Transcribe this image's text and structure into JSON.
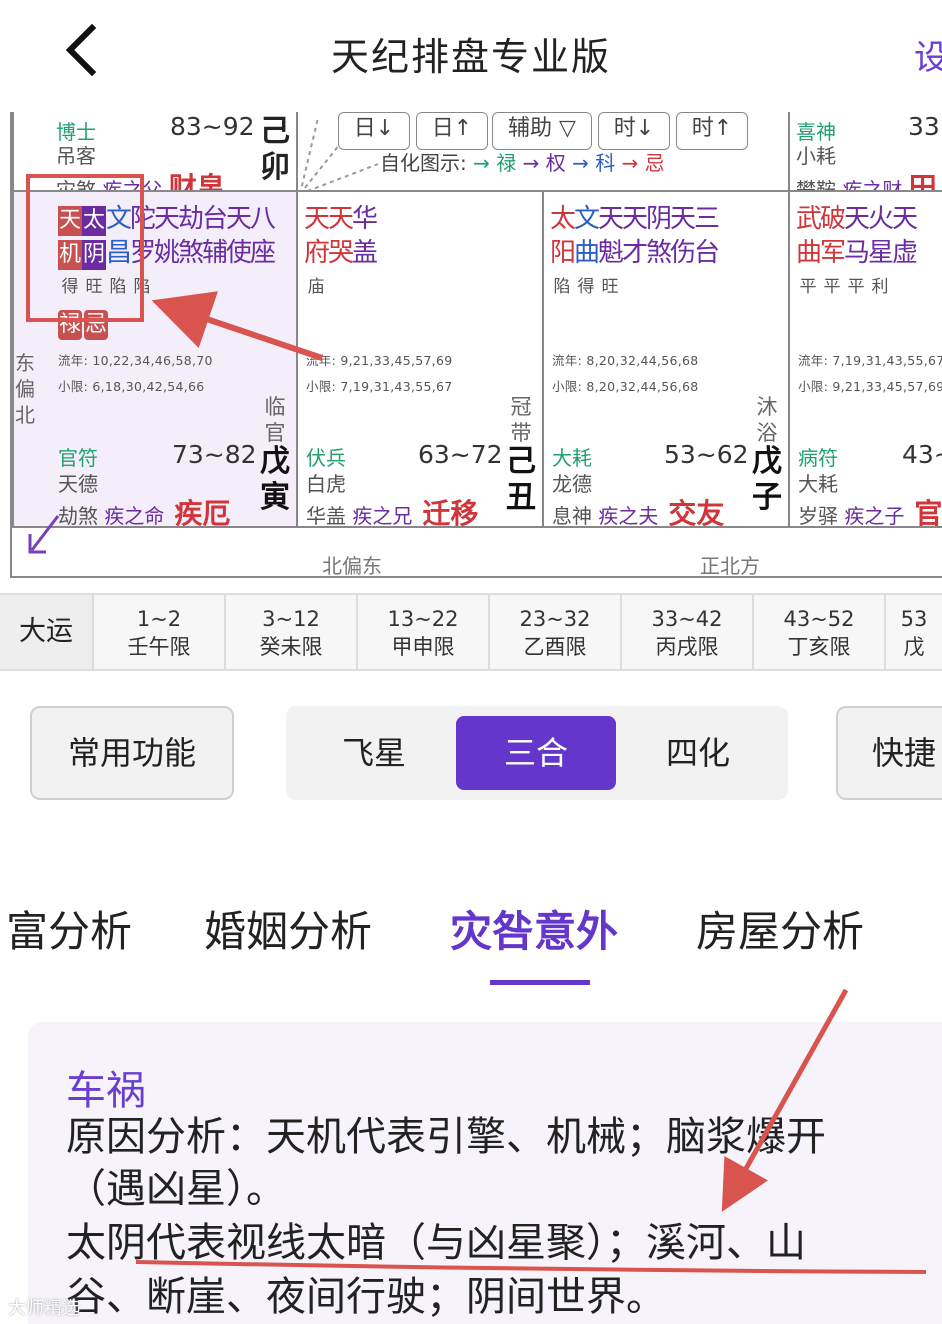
{
  "header": {
    "title": "天纪排盘专业版",
    "right_cut": "设"
  },
  "chart": {
    "top_cells": {
      "c1": {
        "l1": "博士",
        "l2": "吊客",
        "l3a": "灾煞",
        "l3b": "疾之父",
        "pal": "财帛",
        "range": "83~92",
        "stem": "己",
        "branch": "卯"
      },
      "c4": {
        "l1": "喜神",
        "l2": "小耗",
        "l3a": "攀鞍",
        "l3b": "疾之财",
        "pal": "田",
        "range": "33~"
      }
    },
    "center": {
      "btns": [
        "日↓",
        "日↑",
        "辅助 ▽",
        "时↓",
        "时↑"
      ],
      "legend_label": "自化图示:",
      "legend": [
        "→ 禄",
        "→ 权",
        "→ 科",
        "→ 忌"
      ]
    },
    "cells": [
      {
        "stars_r1": [
          "天",
          "太",
          "文",
          "陀",
          "天",
          "劫",
          "台",
          "天",
          "八"
        ],
        "stars_r2": [
          "机",
          "阴",
          "昌",
          "罗",
          "姚",
          "煞",
          "辅",
          "使",
          "座"
        ],
        "bright": [
          "得",
          "旺",
          "陷",
          "陷"
        ],
        "tags": [
          "禄",
          "忌"
        ],
        "liunian": "流年: 10,22,34,46,58,70",
        "xiaoxian": "小限: 6,18,30,42,54,66",
        "state": [
          "临",
          "官"
        ],
        "b1": "官符",
        "b2": "天德",
        "range": "73~82",
        "stem": "戊",
        "branch": "寅",
        "b3a": "劫煞",
        "b3b": "疾之命",
        "pal": "疾厄"
      },
      {
        "stars_r1": [
          "天",
          "天",
          "华"
        ],
        "stars_r2": [
          "府",
          "哭",
          "盖"
        ],
        "bright": [
          "庙"
        ],
        "liunian": "流年: 9,21,33,45,57,69",
        "xiaoxian": "小限: 7,19,31,43,55,67",
        "state": [
          "冠",
          "带"
        ],
        "b1": "伏兵",
        "b2": "白虎",
        "range": "63~72",
        "stem": "己",
        "branch": "丑",
        "b3a": "华盖",
        "b3b": "疾之兄",
        "pal": "迁移"
      },
      {
        "stars_r1": [
          "太",
          "文",
          "天",
          "天",
          "阴",
          "天",
          "三"
        ],
        "stars_r2": [
          "阳",
          "曲",
          "魁",
          "才",
          "煞",
          "伤",
          "台"
        ],
        "bright": [
          "陷",
          "得",
          "旺"
        ],
        "liunian": "流年: 8,20,32,44,56,68",
        "xiaoxian": "小限: 8,20,32,44,56,68",
        "state": [
          "沐",
          "浴"
        ],
        "b1": "大耗",
        "b2": "龙德",
        "range": "53~62",
        "stem": "戊",
        "branch": "子",
        "b3a": "息神",
        "b3b": "疾之夫",
        "pal": "交友"
      },
      {
        "stars_r1": [
          "武",
          "破",
          "天",
          "火",
          "天"
        ],
        "stars_r2": [
          "曲",
          "军",
          "马",
          "星",
          "虚"
        ],
        "bright": [
          "平",
          "平",
          "平",
          "利"
        ],
        "liunian": "流年: 7,19,31,43,55,67",
        "xiaoxian": "小限: 9,21,33,45,57,69",
        "state": [],
        "b1": "病符",
        "b2": "大耗",
        "range": "43~",
        "stem": "",
        "branch": "",
        "b3a": "岁驿",
        "b3b": "疾之子",
        "pal": "官"
      }
    ],
    "dir_side": "东偏北",
    "dir_bottom1": "北偏东",
    "dir_bottom2": "正北方"
  },
  "dayun": {
    "label": "大运",
    "items": [
      {
        "range": "1~2",
        "name": "壬午限"
      },
      {
        "range": "3~12",
        "name": "癸未限"
      },
      {
        "range": "13~22",
        "name": "甲申限"
      },
      {
        "range": "23~32",
        "name": "乙酉限"
      },
      {
        "range": "33~42",
        "name": "丙戌限"
      },
      {
        "range": "43~52",
        "name": "丁亥限"
      },
      {
        "range": "53",
        "name": "戊"
      }
    ]
  },
  "functions": {
    "common": "常用功能",
    "seg": [
      "飞星",
      "三合",
      "四化"
    ],
    "quick": "快捷"
  },
  "tabs": [
    "富分析",
    "婚姻分析",
    "灾咎意外",
    "房屋分析"
  ],
  "card": {
    "title": "车祸",
    "lines": [
      "原因分析：天机代表引擎、机械；脑浆爆开",
      "（遇凶星）。",
      "太阴代表视线太暗（与凶星聚）；溪河、山",
      "谷、断崖、夜间行驶；阴间世界。"
    ]
  },
  "watermark": "大师精选",
  "colors": {
    "accent": "#6436cc",
    "annotation": "#d9534f"
  }
}
